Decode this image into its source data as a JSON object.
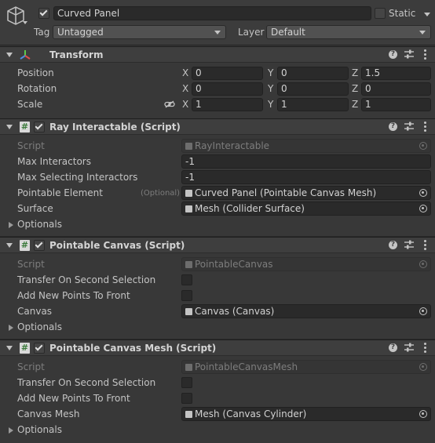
{
  "header": {
    "active": true,
    "name": "Curved Panel",
    "static_label": "Static",
    "static": false,
    "tag_label": "Tag",
    "tag_value": "Untagged",
    "layer_label": "Layer",
    "layer_value": "Default"
  },
  "transform": {
    "title": "Transform",
    "position": {
      "label": "Position",
      "x": "0",
      "y": "0",
      "z": "1.5"
    },
    "rotation": {
      "label": "Rotation",
      "x": "0",
      "y": "0",
      "z": "0"
    },
    "scale": {
      "label": "Scale",
      "x": "1",
      "y": "1",
      "z": "1"
    },
    "axis_x": "X",
    "axis_y": "Y",
    "axis_z": "Z"
  },
  "ray_interactable": {
    "title": "Ray Interactable (Script)",
    "enabled": true,
    "script_label": "Script",
    "script_value": "RayInteractable",
    "max_interactors_label": "Max Interactors",
    "max_interactors_value": "-1",
    "max_selecting_label": "Max Selecting Interactors",
    "max_selecting_value": "-1",
    "pointable_element_label": "Pointable Element",
    "optional_tag": "(Optional)",
    "pointable_element_value": "Curved Panel (Pointable Canvas Mesh)",
    "surface_label": "Surface",
    "surface_value": "Mesh (Collider Surface)",
    "optionals_label": "Optionals"
  },
  "pointable_canvas": {
    "title": "Pointable Canvas (Script)",
    "enabled": true,
    "script_label": "Script",
    "script_value": "PointableCanvas",
    "transfer_label": "Transfer On Second Selection",
    "transfer_value": false,
    "add_points_label": "Add New Points To Front",
    "add_points_value": false,
    "canvas_label": "Canvas",
    "canvas_value": "Canvas (Canvas)",
    "optionals_label": "Optionals"
  },
  "pointable_canvas_mesh": {
    "title": "Pointable Canvas Mesh (Script)",
    "enabled": true,
    "script_label": "Script",
    "script_value": "PointableCanvasMesh",
    "transfer_label": "Transfer On Second Selection",
    "transfer_value": false,
    "add_points_label": "Add New Points To Front",
    "add_points_value": false,
    "canvas_mesh_label": "Canvas Mesh",
    "canvas_mesh_value": "Mesh (Canvas Cylinder)",
    "optionals_label": "Optionals"
  },
  "icons": {
    "gameobject": "cube-icon",
    "transform": "transform-axes-icon",
    "script": "script-hash-icon",
    "help": "help-icon",
    "preset": "preset-sliders-icon",
    "menu": "kebab-menu-icon",
    "link": "constrain-proportions-link-icon",
    "picker": "object-picker-icon"
  },
  "colors": {
    "background": "#383838",
    "header": "#3e3e3e",
    "field": "#2a2a2a",
    "text": "#c4c4c4",
    "dim_text": "#7d7d7d",
    "axis_red": "#e04b4b",
    "axis_green": "#5ec94d",
    "axis_blue": "#4e8de0",
    "script_green": "#3a7a3a"
  }
}
